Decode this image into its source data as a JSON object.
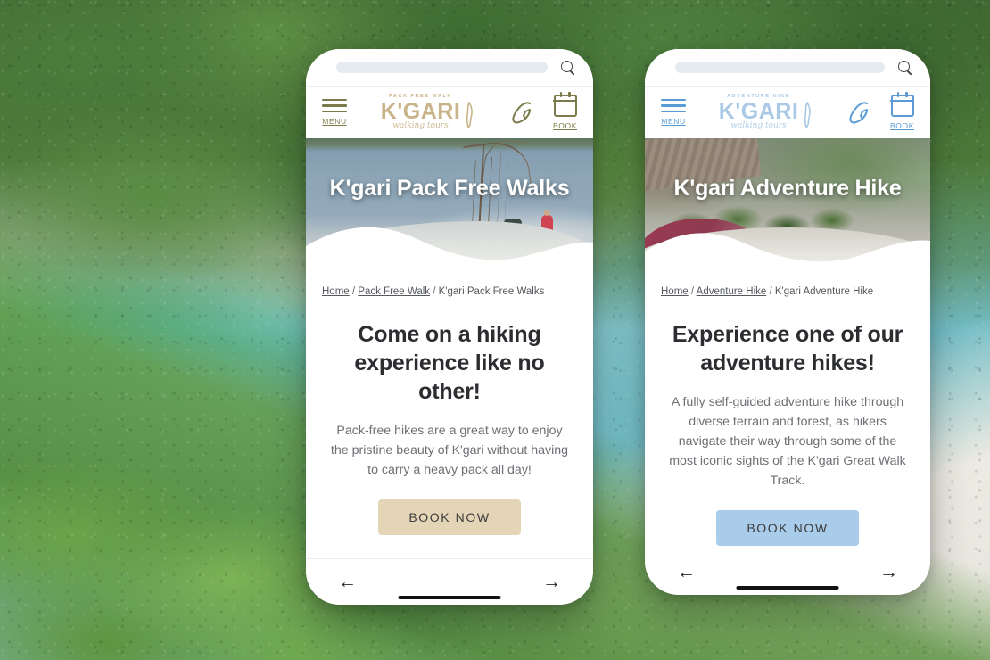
{
  "scene": {
    "background_description": "aerial photo of K'gari forest, turquoise lake and white sand beach",
    "colors": {
      "tan_accent": "#e4d5b7",
      "tan_logo": "#c9b48a",
      "olive_icon": "#7b7a4a",
      "blue_accent": "#a9cceb",
      "blue_logo": "#a9c9e6",
      "blue_icon": "#5b9bd5",
      "heading": "#2b2d30",
      "body_text": "#6d7074"
    }
  },
  "phones": [
    {
      "id": "pack-free-walk",
      "browser": {
        "url_value": "",
        "url_placeholder": "",
        "search_icon": "search-icon",
        "back_arrow": "←",
        "forward_arrow": "→"
      },
      "header": {
        "menu_label": "MENU",
        "menu_icon": "hamburger-icon",
        "phone_icon": "phone-icon",
        "book_label": "BOOK",
        "book_icon": "calendar-icon",
        "logo": {
          "kicker": "PACK FREE WALK",
          "brand": "K'GARI",
          "script": "walking tours",
          "island_icon": "island-shape-icon"
        }
      },
      "hero": {
        "title": "K'gari Pack Free Walks",
        "image_alt": "hiker with pack resting by a tree on the lake shore"
      },
      "breadcrumb": {
        "items": [
          {
            "label": "Home",
            "link": true
          },
          {
            "label": "Pack Free Walk",
            "link": true
          },
          {
            "label": "K'gari Pack Free Walks",
            "link": false
          }
        ],
        "separator": "/"
      },
      "main": {
        "heading": "Come on a hiking experience like no other!",
        "paragraph": "Pack-free hikes are a great way to enjoy the pristine beauty of K'gari without having to carry a heavy pack all day!",
        "cta_label": "BOOK NOW"
      }
    },
    {
      "id": "adventure-hike",
      "browser": {
        "url_value": "",
        "url_placeholder": "",
        "search_icon": "search-icon",
        "back_arrow": "←",
        "forward_arrow": "→"
      },
      "header": {
        "menu_label": "MENU",
        "menu_icon": "hamburger-icon",
        "phone_icon": "phone-icon",
        "book_label": "BOOK",
        "book_icon": "calendar-icon",
        "logo": {
          "kicker": "ADVENTURE HIKE",
          "brand": "K'GARI",
          "script": "walking tours",
          "island_icon": "island-shape-icon"
        }
      },
      "hero": {
        "title": "K'gari Adventure Hike",
        "image_alt": "camp shelter and scrub beside a sand track"
      },
      "breadcrumb": {
        "items": [
          {
            "label": "Home",
            "link": true
          },
          {
            "label": "Adventure Hike",
            "link": true
          },
          {
            "label": "K'gari Adventure Hike",
            "link": false
          }
        ],
        "separator": "/"
      },
      "main": {
        "heading": "Experience one of our adventure hikes!",
        "paragraph": "A fully self-guided adventure hike through diverse terrain and forest, as hikers navigate their way through some of the most iconic sights of the K'gari Great Walk Track.",
        "cta_label": "BOOK NOW"
      }
    }
  ]
}
